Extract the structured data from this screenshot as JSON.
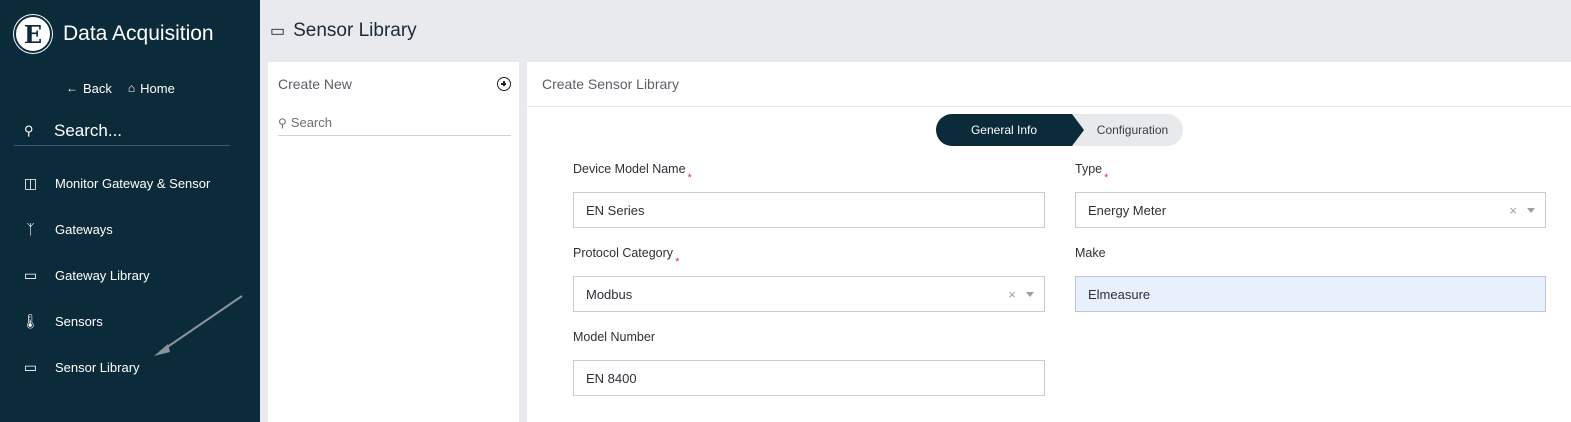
{
  "sidebar": {
    "logo_letter": "E",
    "app_title": "Data Acquisition",
    "back_label": "Back",
    "home_label": "Home",
    "search_placeholder": "Search...",
    "items": [
      {
        "label": "Monitor Gateway & Sensor",
        "icon": "dashboard-icon"
      },
      {
        "label": "Gateways",
        "icon": "fork-icon"
      },
      {
        "label": "Gateway Library",
        "icon": "book-icon"
      },
      {
        "label": "Sensors",
        "icon": "thermometer-icon"
      },
      {
        "label": "Sensor Library",
        "icon": "book-icon"
      }
    ]
  },
  "header": {
    "title": "Sensor Library",
    "icon": "book-icon"
  },
  "list_panel": {
    "title": "Create New",
    "search_placeholder": "Search"
  },
  "form": {
    "title": "Create Sensor Library",
    "steps": [
      {
        "label": "General Info",
        "active": true
      },
      {
        "label": "Configuration",
        "active": false
      }
    ],
    "fields": {
      "device_model_name": {
        "label": "Device Model Name",
        "value": "EN Series",
        "required": true
      },
      "type": {
        "label": "Type",
        "value": "Energy Meter",
        "required": true
      },
      "protocol_category": {
        "label": "Protocol Category",
        "value": "Modbus",
        "required": true
      },
      "make": {
        "label": "Make",
        "value": "Elmeasure",
        "required": false
      },
      "model_number": {
        "label": "Model Number",
        "value": "EN 8400",
        "required": false
      }
    },
    "required_mark": "*",
    "clear_glyph": "×"
  },
  "colors": {
    "sidebar_bg": "#0b2a3a",
    "active_step": "#0b2a3a",
    "required": "#e03b3b",
    "autofill": "#e8f0fe"
  }
}
